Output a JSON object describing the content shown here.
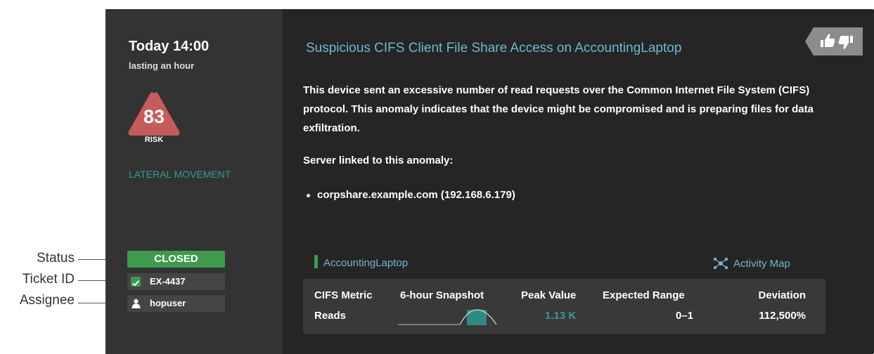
{
  "callouts": [
    "Status",
    "Ticket ID",
    "Assignee"
  ],
  "sidebar": {
    "time": "Today 14:00",
    "duration": "lasting an hour",
    "risk_score": "83",
    "risk_label": "RISK",
    "category": "LATERAL MOVEMENT",
    "status": "CLOSED",
    "ticket_id": "EX-4437",
    "assignee": "hopuser"
  },
  "detection": {
    "title": "Suspicious CIFS Client File Share Access on AccountingLaptop",
    "description": "This device sent an excessive number of read requests over the Common Internet File System (CIFS) protocol. This anomaly indicates that the device might be compromised and is preparing files for data exfiltration.",
    "server_label": "Server linked to this anomaly:",
    "servers": [
      "corpshare.example.com (192.168.6.179)"
    ]
  },
  "device": {
    "name": "AccountingLaptop",
    "activity_map_label": "Activity Map"
  },
  "metrics": {
    "headers": [
      "CIFS Metric",
      "6-hour Snapshot",
      "Peak Value",
      "Expected Range",
      "Deviation"
    ],
    "rows": [
      {
        "metric": "Reads",
        "peak": "1.13 K",
        "expected": "0–1",
        "deviation": "112,500%"
      }
    ]
  },
  "colors": {
    "accent_link": "#6fb7d1",
    "status_green": "#3e9a4d",
    "risk_red": "#c75b5b",
    "teal": "#3a9a94"
  },
  "icons": [
    "thumbs-up-icon",
    "thumbs-down-icon",
    "checkmark-icon",
    "user-icon",
    "activity-map-icon"
  ]
}
